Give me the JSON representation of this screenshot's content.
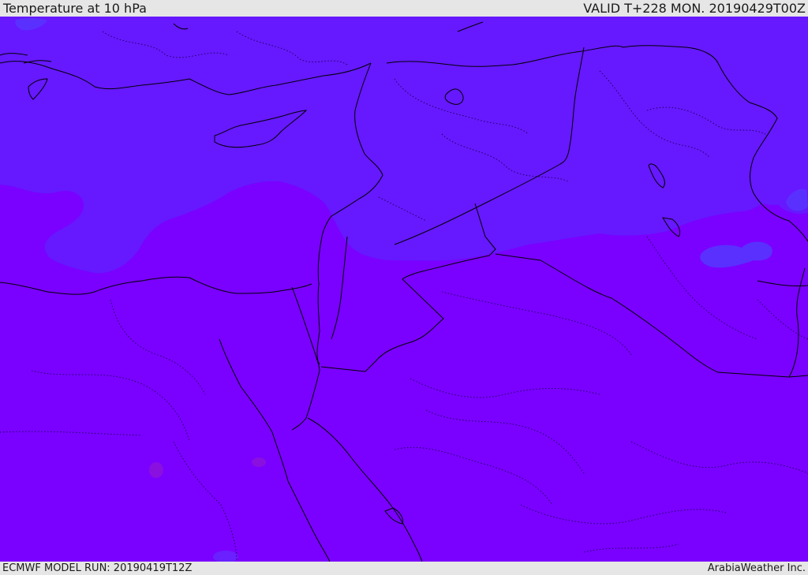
{
  "header": {
    "title": "Temperature at 10 hPa",
    "valid": "VALID T+228 MON. 20190429T00Z"
  },
  "footer": {
    "model_run": "ECMWF MODEL RUN: 20190419T12Z",
    "credit": "ArabiaWeather Inc."
  },
  "map": {
    "colors": {
      "warm_fill": "#7a00ff",
      "cool_fill": "#6618ff",
      "cooler_patch": "#5a30ff",
      "warmer_spot": "#8a10e0",
      "coastline": "#000000"
    }
  }
}
